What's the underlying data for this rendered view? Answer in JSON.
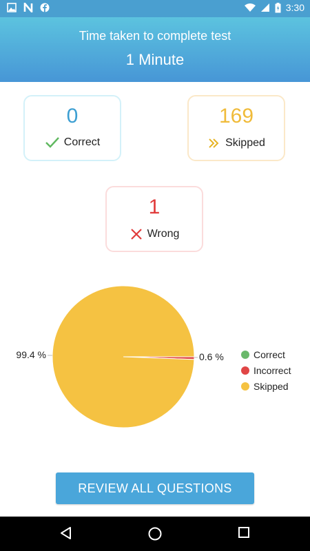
{
  "status_bar": {
    "time": "3:30",
    "left_icons": [
      "image-icon",
      "n-icon",
      "facebook-icon"
    ],
    "right_icons": [
      "wifi-icon",
      "signal-icon",
      "battery-icon"
    ]
  },
  "header": {
    "label": "Time taken to complete test",
    "value": "1 Minute"
  },
  "stats": {
    "correct": {
      "count": "0",
      "label": "Correct",
      "icon": "check-icon",
      "color": "#3d9fd2"
    },
    "skipped": {
      "count": "169",
      "label": "Skipped",
      "icon": "double-chevron-right-icon",
      "color": "#f0bb3a"
    },
    "wrong": {
      "count": "1",
      "label": "Wrong",
      "icon": "cross-icon",
      "color": "#e03a3a"
    }
  },
  "chart_data": {
    "type": "pie",
    "categories": [
      "Correct",
      "Incorrect",
      "Skipped"
    ],
    "values": [
      0,
      0.6,
      99.4
    ],
    "colors": [
      "#6ab96b",
      "#e04646",
      "#f5c242"
    ],
    "data_labels": [
      "0.6 %",
      "99.4 %"
    ],
    "legend": "right"
  },
  "review_button": {
    "label": "REVIEW ALL QUESTIONS"
  },
  "nav": {
    "icons": [
      "back-icon",
      "home-icon",
      "recents-icon"
    ]
  }
}
